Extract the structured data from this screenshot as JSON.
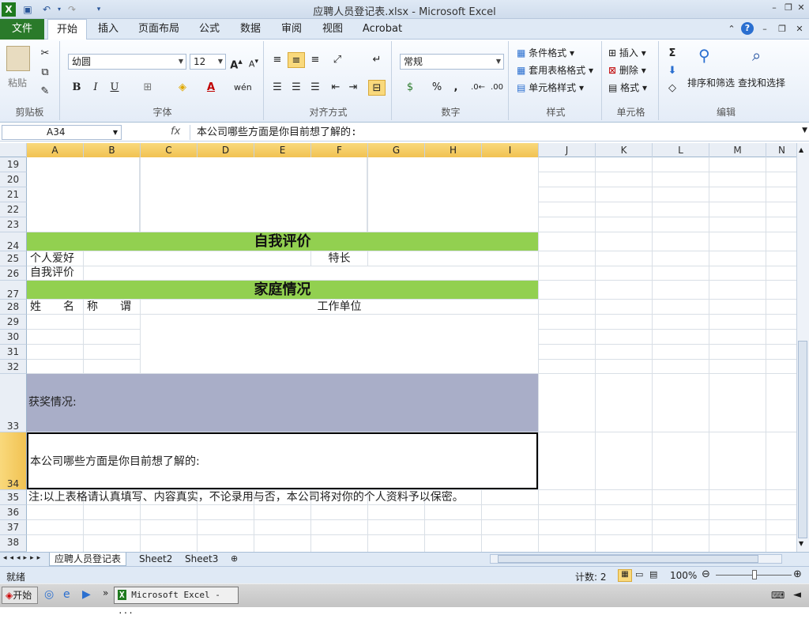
{
  "window": {
    "title": "应聘人员登记表.xlsx - Microsoft Excel"
  },
  "ribbon_tabs": [
    "文件",
    "开始",
    "插入",
    "页面布局",
    "公式",
    "数据",
    "审阅",
    "视图",
    "Acrobat"
  ],
  "ribbon": {
    "clipboard": {
      "paste": "粘贴",
      "label": "剪贴板"
    },
    "font": {
      "name": "幼圆",
      "size": "12",
      "bold": "B",
      "italic": "I",
      "underline": "U",
      "label": "字体"
    },
    "alignment": {
      "label": "对齐方式"
    },
    "number": {
      "format": "常规",
      "percent": "%",
      "comma": ",",
      "label": "数字"
    },
    "styles": {
      "conditional": "条件格式",
      "table": "套用表格格式",
      "cell": "单元格样式",
      "label": "样式"
    },
    "cells": {
      "insert": "插入",
      "delete": "删除",
      "format": "格式",
      "label": "单元格"
    },
    "editing": {
      "sort": "排序和筛选",
      "find": "查找和选择",
      "label": "编辑"
    }
  },
  "formula_bar": {
    "name_box": "A34",
    "fx": "fx",
    "content": "本公司哪些方面是你目前想了解的:"
  },
  "columns": [
    "A",
    "B",
    "C",
    "D",
    "E",
    "F",
    "G",
    "H",
    "I",
    "J",
    "K",
    "L",
    "M",
    "N"
  ],
  "rows": [
    "19",
    "20",
    "21",
    "22",
    "23",
    "24",
    "25",
    "26",
    "27",
    "28",
    "29",
    "30",
    "31",
    "32",
    "33",
    "34",
    "35",
    "36",
    "37",
    "38"
  ],
  "cells": {
    "self_eval_header": "自我评价",
    "hobby": "个人爱好",
    "specialty": "特长",
    "self_eval": "自我评价",
    "family_header": "家庭情况",
    "name": "姓　　名",
    "relation": "称　　谓",
    "workplace": "工作单位",
    "awards": "获奖情况:",
    "question": "本公司哪些方面是你目前想了解的:",
    "note": "注:以上表格请认真填写、内容真实，不论录用与否，本公司将对你的个人资料予以保密。"
  },
  "sheets": [
    "应聘人员登记表",
    "Sheet2",
    "Sheet3"
  ],
  "status": {
    "ready": "就绪",
    "count": "计数: 2",
    "zoom": "100%"
  },
  "taskbar": {
    "start": "开始",
    "app": "Microsoft Excel - ..."
  },
  "colors": {
    "band_green": "#92d050",
    "awards_fill": "#a9aec8",
    "file_tab": "#2a7a2a"
  }
}
